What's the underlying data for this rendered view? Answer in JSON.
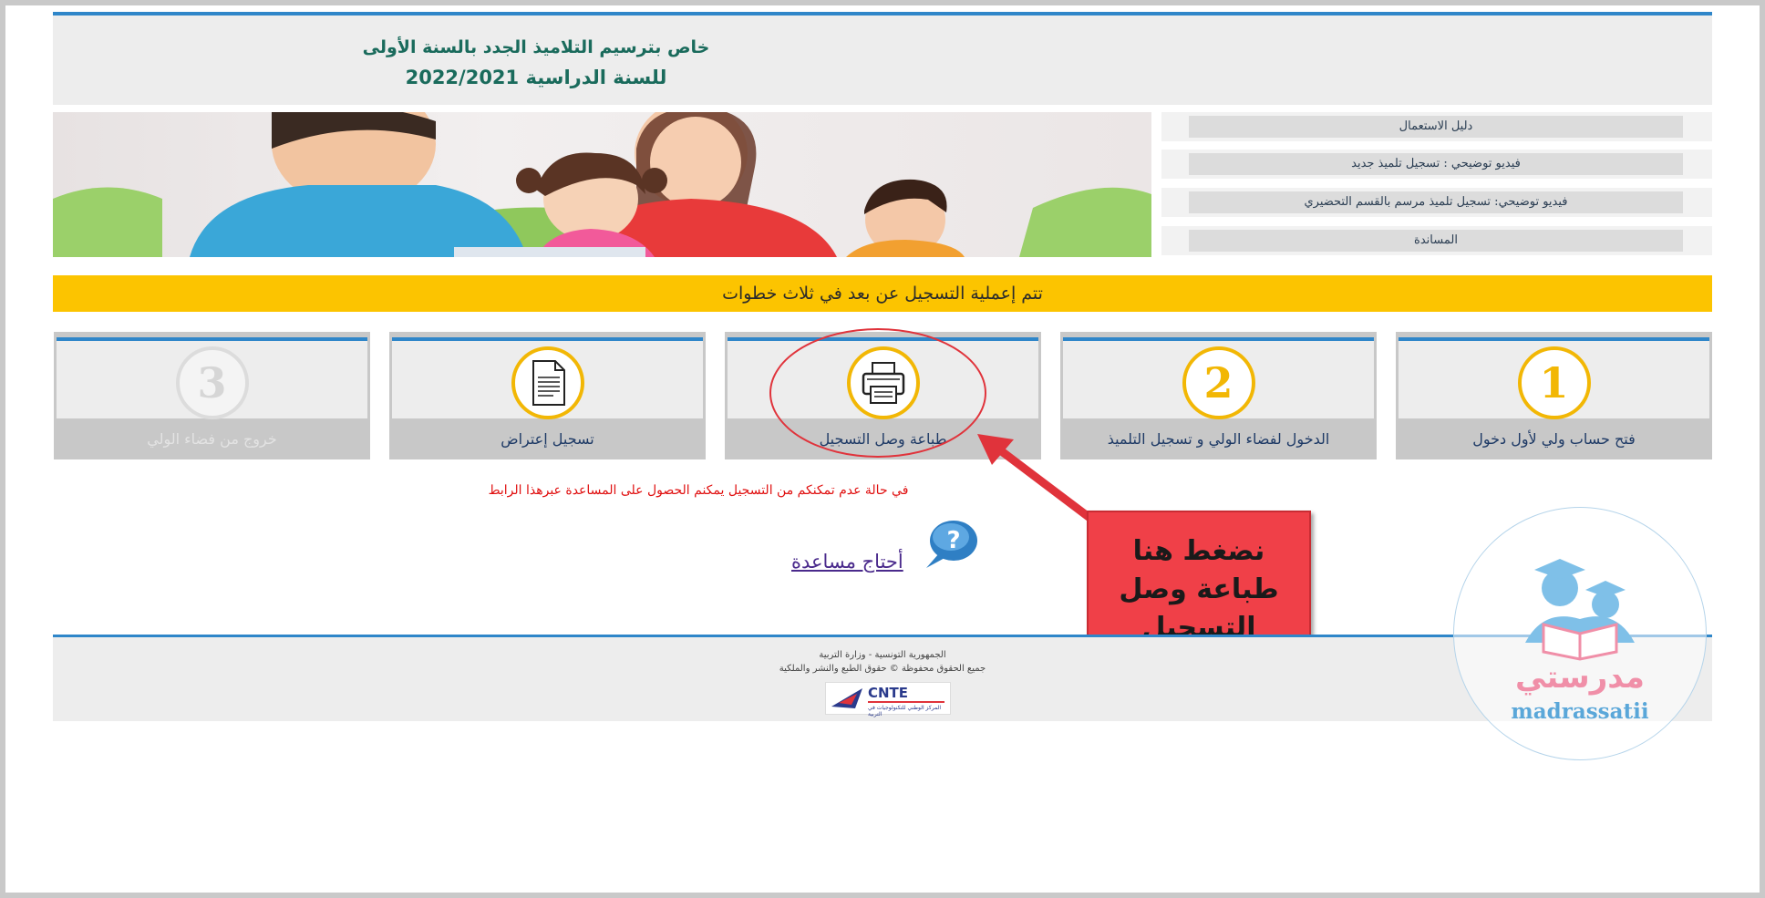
{
  "header": {
    "title_line1": "خاص بترسيم التلاميذ الجدد بالسنة الأولى",
    "title_line2": "للسنة الدراسية 2022/2021"
  },
  "menu": {
    "items": [
      {
        "label": "دليل الاستعمال"
      },
      {
        "label": "فيديو توضيحي : تسجيل تلميذ جديد"
      },
      {
        "label": "فيديو توضيحي: تسجيل تلميذ مرسم بالقسم التحضيري"
      },
      {
        "label": "المساندة"
      }
    ]
  },
  "steps_bar": {
    "text": "تتم إعملية التسجيل عن بعد في ثلاث خطوات"
  },
  "steps": [
    {
      "number": "1",
      "label": "فتح حساب ولي لأول دخول",
      "enabled": true
    },
    {
      "number": "2",
      "label": "الدخول لفضاء الولي و تسجيل التلميذ",
      "enabled": true
    },
    {
      "icon": "printer-icon",
      "label": "طباعة وصل التسجيل",
      "enabled": true
    },
    {
      "icon": "document-icon",
      "label": "تسجيل إعتراض",
      "enabled": true
    },
    {
      "number": "3",
      "label": "خروج من فضاء الولي",
      "enabled": false
    }
  ],
  "help": {
    "text": "في حالة عدم تمكنكم من التسجيل يمكنم الحصول على المساعدة عبرهذا الرابط",
    "link": "أحتاج مساعدة",
    "bubble": "?"
  },
  "annotation": {
    "callout_line1": "نضغط هنا",
    "callout_line2": "طباعة وصل",
    "callout_line3": "التسجيل"
  },
  "footer": {
    "line1": "الجمهورية التونسية - وزارة التربية",
    "line2": "جميع الحقوق محفوظة © حقوق الطبع والنشر والملكية",
    "logo_text": "CNTE",
    "logo_subtitle": "المركز الوطني للتكنولوجيات في التربية"
  },
  "watermark": {
    "arabic": "مدرستي",
    "latin": "madrassatii"
  },
  "colors": {
    "accent_blue": "#2f86c9",
    "banner_yellow": "#fcc400",
    "step_circle": "#f2b705",
    "annotation_red": "#f04048"
  }
}
